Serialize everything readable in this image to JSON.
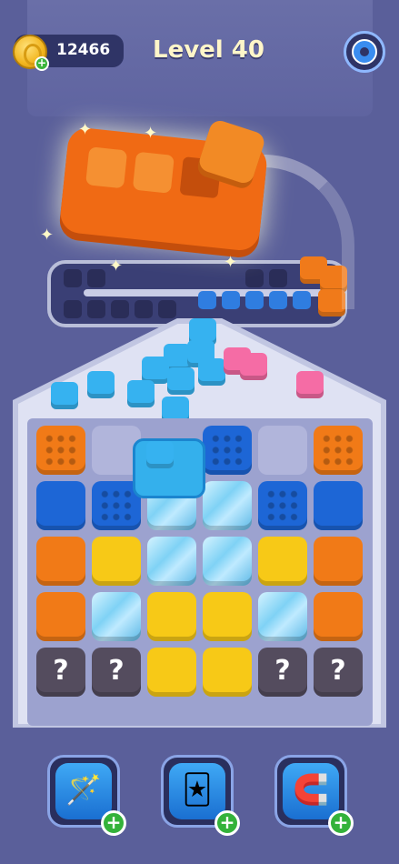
{
  "header": {
    "coins": "12466",
    "level": "Level 40"
  },
  "icons": {
    "coin": "coin-icon",
    "settings": "gear-icon",
    "boosters": [
      "magic-wand-icon",
      "jester-hat-icon",
      "magnet-icon"
    ]
  },
  "board": {
    "rows": [
      [
        "orange-crate",
        "empty",
        "cube-holder",
        "blue-crate",
        "empty",
        "orange-crate"
      ],
      [
        "blue",
        "blue-crate",
        "ice",
        "ice",
        "blue-crate",
        "blue"
      ],
      [
        "orange",
        "yellow",
        "ice",
        "ice",
        "yellow",
        "orange"
      ],
      [
        "orange",
        "ice",
        "yellow",
        "yellow",
        "ice",
        "orange"
      ],
      [
        "mystery",
        "mystery",
        "yellow",
        "yellow",
        "mystery",
        "mystery"
      ]
    ],
    "mystery_label": "?"
  },
  "colors": {
    "blue": "#1d66d6",
    "orange": "#f17a17",
    "yellow": "#f7c917",
    "cube_blue": "#36b2f0",
    "cube_pink": "#f56ca5"
  }
}
